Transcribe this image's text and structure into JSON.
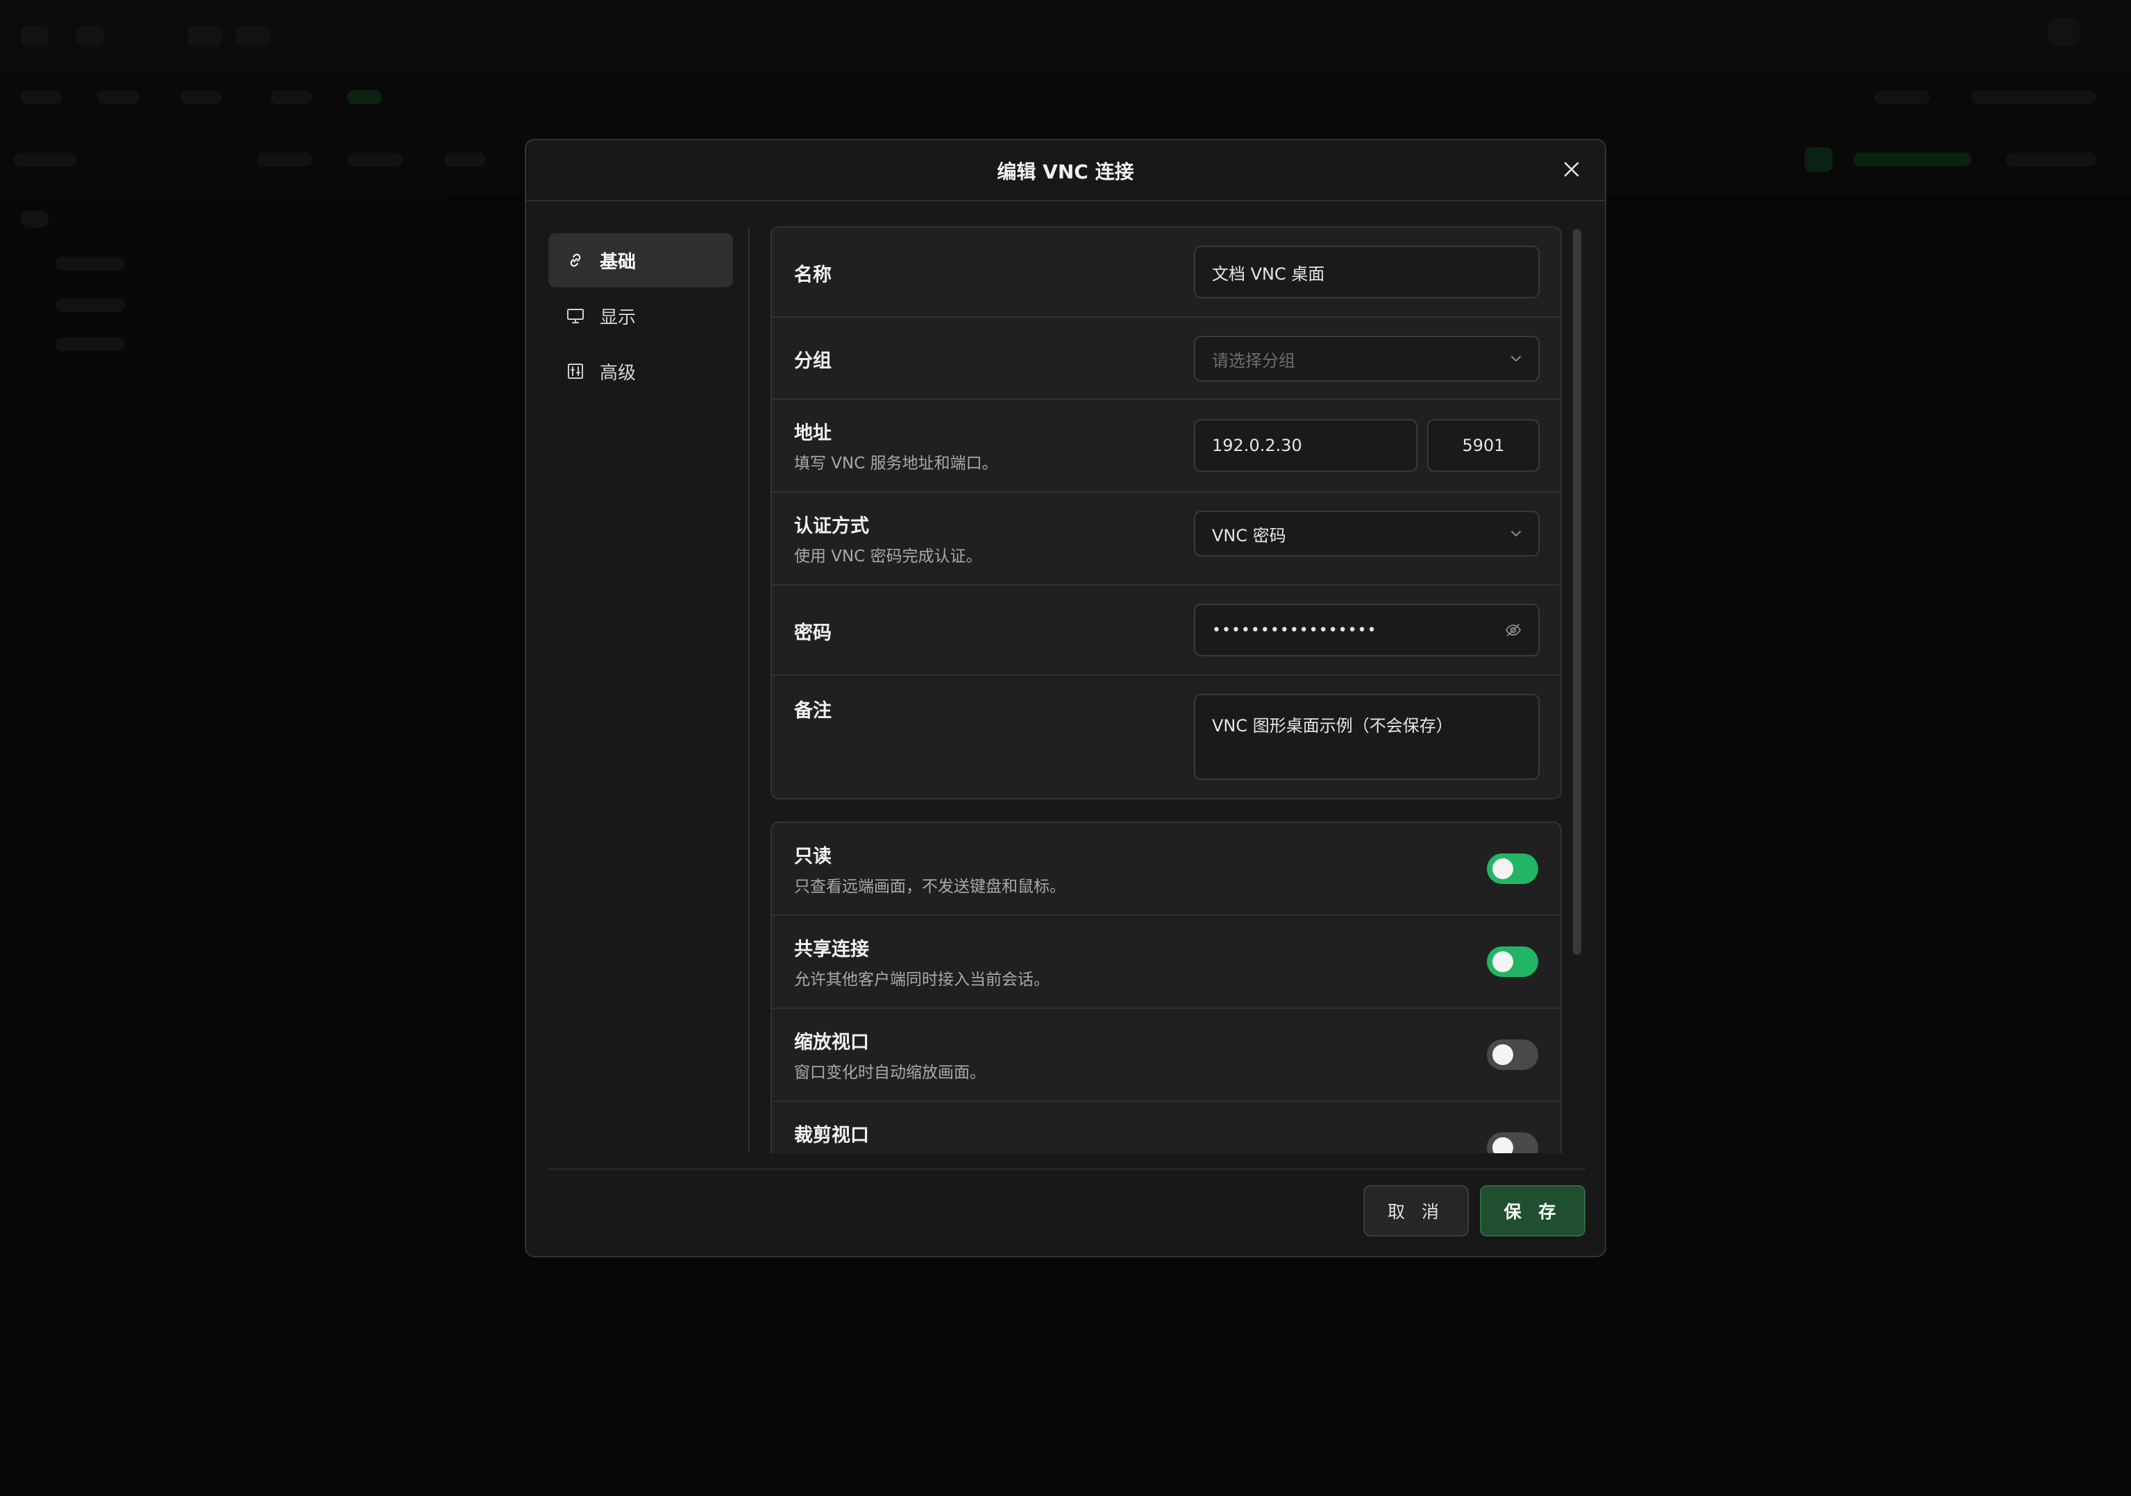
{
  "dialog": {
    "title": "编辑 VNC 连接"
  },
  "nav": {
    "items": [
      {
        "label": "基础",
        "icon": "link-icon",
        "active": true
      },
      {
        "label": "显示",
        "icon": "monitor-icon",
        "active": false
      },
      {
        "label": "高级",
        "icon": "sliders-icon",
        "active": false
      }
    ]
  },
  "form": {
    "name": {
      "label": "名称",
      "value": "文档 VNC 桌面"
    },
    "group": {
      "label": "分组",
      "placeholder": "请选择分组"
    },
    "address": {
      "label": "地址",
      "description": "填写 VNC 服务地址和端口。",
      "host": "192.0.2.30",
      "port": "5901"
    },
    "auth": {
      "label": "认证方式",
      "description": "使用 VNC 密码完成认证。",
      "value": "VNC 密码"
    },
    "password": {
      "label": "密码",
      "masked": "•••••••••••••••••"
    },
    "notes": {
      "label": "备注",
      "value": "VNC 图形桌面示例（不会保存）"
    }
  },
  "toggles": [
    {
      "label": "只读",
      "description": "只查看远端画面，不发送键盘和鼠标。",
      "on": true
    },
    {
      "label": "共享连接",
      "description": "允许其他客户端同时接入当前会话。",
      "on": true
    },
    {
      "label": "缩放视口",
      "description": "窗口变化时自动缩放画面。",
      "on": false
    },
    {
      "label": "裁剪视口",
      "description": "",
      "on": false
    }
  ],
  "footer": {
    "cancel": "取 消",
    "save": "保 存"
  },
  "colors": {
    "accent": "#21b565",
    "save_button": "#1f4f2f",
    "dialog_bg": "#181818"
  }
}
